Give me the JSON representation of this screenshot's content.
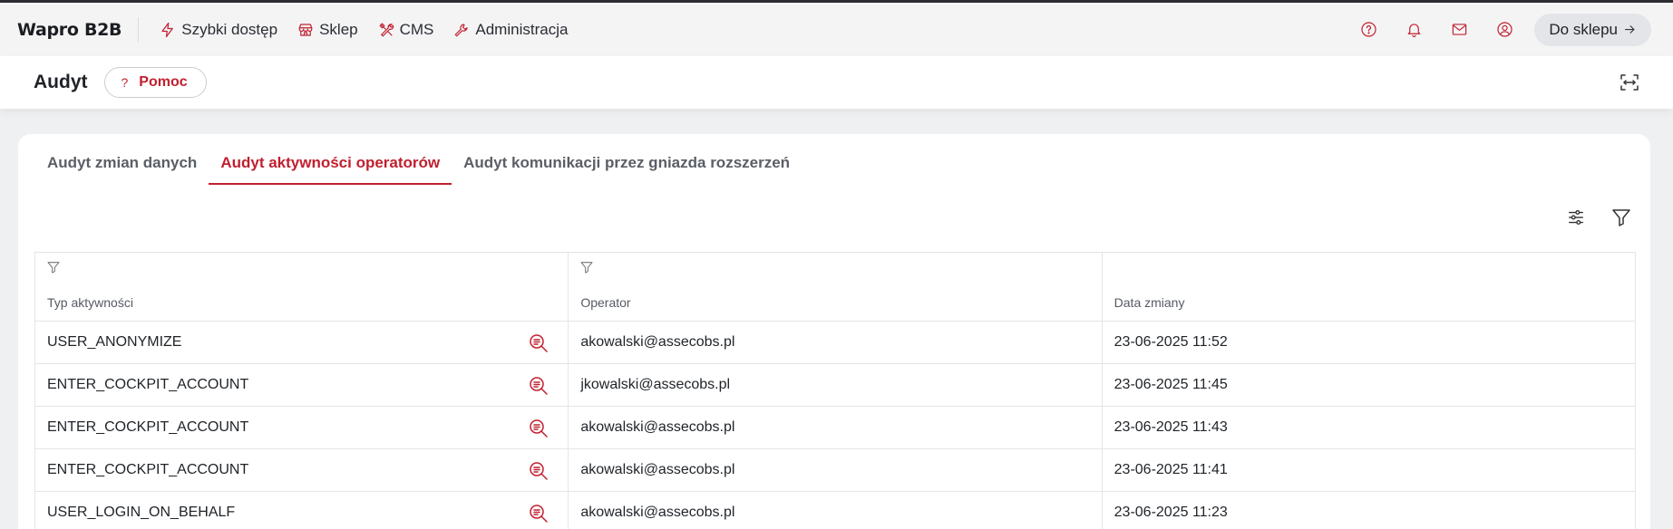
{
  "brand": "Wapro B2B",
  "nav": [
    {
      "label": "Szybki dostęp",
      "icon": "lightning-icon"
    },
    {
      "label": "Sklep",
      "icon": "store-icon"
    },
    {
      "label": "CMS",
      "icon": "tools-icon"
    },
    {
      "label": "Administracja",
      "icon": "wrench-icon"
    }
  ],
  "topbar_icons": [
    "help-circle-icon",
    "bell-icon",
    "mail-icon",
    "user-icon"
  ],
  "shop_button": {
    "label": "Do sklepu",
    "icon": "arrow-right-icon"
  },
  "page": {
    "title": "Audyt",
    "help_label": "Pomoc",
    "help_icon": "?"
  },
  "tabs": [
    {
      "label": "Audyt zmian danych",
      "active": false
    },
    {
      "label": "Audyt aktywności operatorów",
      "active": true
    },
    {
      "label": "Audyt komunikacji przez gniazda rozszerzeń",
      "active": false
    }
  ],
  "tools": [
    "settings-sliders-icon",
    "filter-icon"
  ],
  "table": {
    "columns": [
      {
        "label": "Typ aktywności",
        "filterable": true
      },
      {
        "label": "Operator",
        "filterable": true
      },
      {
        "label": "Data zmiany",
        "filterable": false
      }
    ],
    "rows": [
      {
        "type": "USER_ANONYMIZE",
        "operator": "akowalski@assecobs.pl",
        "date": "23-06-2025 11:52"
      },
      {
        "type": "ENTER_COCKPIT_ACCOUNT",
        "operator": "jkowalski@assecobs.pl",
        "date": "23-06-2025 11:45"
      },
      {
        "type": "ENTER_COCKPIT_ACCOUNT",
        "operator": "akowalski@assecobs.pl",
        "date": "23-06-2025 11:43"
      },
      {
        "type": "ENTER_COCKPIT_ACCOUNT",
        "operator": "akowalski@assecobs.pl",
        "date": "23-06-2025 11:41"
      },
      {
        "type": "USER_LOGIN_ON_BEHALF",
        "operator": "akowalski@assecobs.pl",
        "date": "23-06-2025 11:23"
      }
    ]
  },
  "colors": {
    "accent": "#c0202f",
    "topbar_bg": "#f4f4f5",
    "page_bg": "#eff0f2"
  }
}
